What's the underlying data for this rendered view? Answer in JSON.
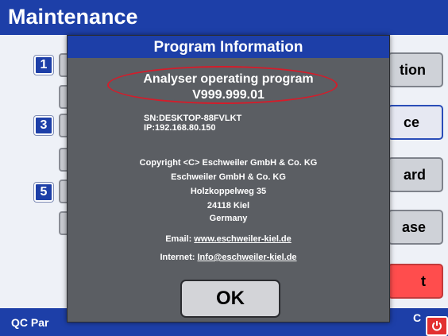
{
  "window": {
    "title": "Maintenance"
  },
  "left_panel": {
    "numbers": [
      "1",
      "3",
      "5"
    ]
  },
  "right_buttons": [
    {
      "label": "tion"
    },
    {
      "label": "ce"
    },
    {
      "label": "ard"
    },
    {
      "label": "ase"
    },
    {
      "label": "t"
    }
  ],
  "bottom_bar": {
    "left_label": "QC Par",
    "right_label": "C"
  },
  "dialog": {
    "title": "Program Information",
    "program_name": "Analyser operating program",
    "program_version": "V999.999.01",
    "sn": "SN:DESKTOP-88FVLKT",
    "ip": "IP:192.168.80.150",
    "copyright_lines": [
      "Copyright <C> Eschweiler GmbH & Co. KG",
      "Eschweiler GmbH & Co. KG",
      "Holzkoppelweg 35",
      "24118 Kiel",
      "Germany"
    ],
    "email_label": "Email:",
    "email_value": "www.eschweiler-kiel.de",
    "internet_label": "Internet:",
    "internet_value": "Info@eschweiler-kiel.de",
    "ok_label": "OK"
  },
  "colors": {
    "title_blue": "#1d3fa8",
    "dialog_gray": "#5b5e63",
    "highlight_red": "#d51c2a",
    "power_red": "#e23030"
  },
  "icons": {
    "power": "power-icon"
  }
}
